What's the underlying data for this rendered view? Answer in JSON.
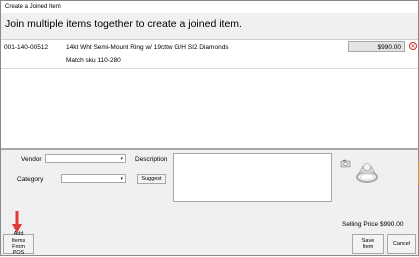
{
  "window": {
    "title": "Create a Joined Item"
  },
  "header": {
    "text": "Join multiple items together to create a joined item."
  },
  "items": [
    {
      "sku": "001-140-00512",
      "description": "14kt Wht Semi-Mount Ring w/ 19cttw G/H SI2 Diamonds",
      "match": "Match sku 110-280",
      "price": "$990.00"
    }
  ],
  "form": {
    "vendor_label": "Vendor",
    "category_label": "Category",
    "description_label": "Description",
    "suggest_label": "Suggest",
    "vendor_value": "",
    "category_value": "",
    "description_value": ""
  },
  "footer": {
    "selling_price_label": "Selling Price",
    "selling_price_value": "$990.00",
    "add_items_label": "Add Items From POS",
    "save_label": "Save Item",
    "cancel_label": "Cancel"
  },
  "icons": {
    "camera": "camera-icon",
    "ring": "ring-photo",
    "remove": "remove-circle-icon",
    "arrow": "red-down-arrow"
  },
  "colors": {
    "remove": "#d03030",
    "arrow": "#e03a3a",
    "tab": "#f7e83a"
  }
}
